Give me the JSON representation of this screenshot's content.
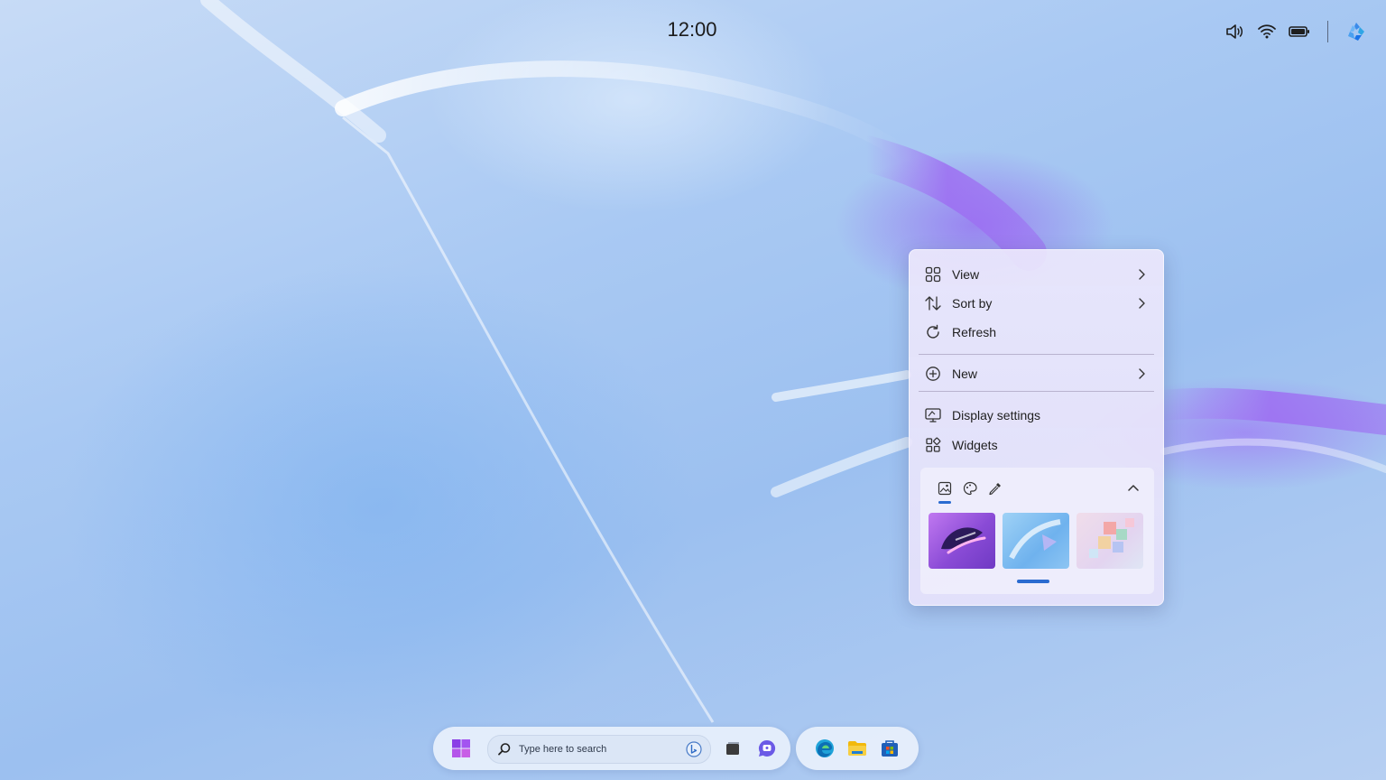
{
  "topbar": {
    "clock": "12:00",
    "tray_icons": [
      "volume-icon",
      "wifi-icon",
      "battery-icon",
      "copilot-icon"
    ]
  },
  "context_menu": {
    "items": [
      {
        "label": "View",
        "icon": "grid-view-icon",
        "submenu": true
      },
      {
        "label": "Sort by",
        "icon": "sort-icon",
        "submenu": true
      },
      {
        "label": "Refresh",
        "icon": "refresh-icon",
        "submenu": false
      },
      {
        "label": "New",
        "icon": "plus-circle-icon",
        "submenu": true
      },
      {
        "label": "Display settings",
        "icon": "display-icon",
        "submenu": false
      },
      {
        "label": "Widgets",
        "icon": "widgets-icon",
        "submenu": false
      }
    ],
    "personalize_panel": {
      "tabs": [
        "wallpaper-icon",
        "theme-icon",
        "color-picker-icon"
      ],
      "active_tab": 0,
      "thumbnails": [
        "purple-abstract-wallpaper",
        "blue-glass-wallpaper",
        "pastel-cubes-wallpaper"
      ],
      "collapse_icon": "chevron-up-icon"
    }
  },
  "taskbar": {
    "search_placeholder": "Type here to search",
    "icons": [
      "windows-start-icon",
      "search-icon",
      "bing-icon",
      "task-view-icon",
      "chat-icon",
      "edge-icon",
      "file-explorer-icon",
      "store-icon"
    ]
  },
  "colors": {
    "accent": "#2a6bd0",
    "wallpaper_blue": "#a9c9f3",
    "wallpaper_purple": "#9a72f0"
  }
}
